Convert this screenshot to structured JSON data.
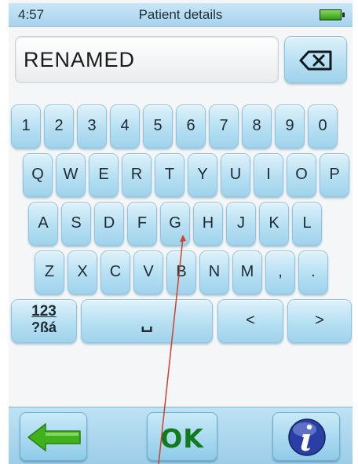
{
  "status": {
    "time": "4:57",
    "title": "Patient details"
  },
  "input": {
    "value": "RENAMED"
  },
  "keyboard": {
    "row1": [
      "1",
      "2",
      "3",
      "4",
      "5",
      "6",
      "7",
      "8",
      "9",
      "0"
    ],
    "row2": [
      "Q",
      "W",
      "E",
      "R",
      "T",
      "Y",
      "U",
      "I",
      "O",
      "P"
    ],
    "row3": [
      "A",
      "S",
      "D",
      "F",
      "G",
      "H",
      "J",
      "K",
      "L"
    ],
    "row4": [
      "Z",
      "X",
      "C",
      "V",
      "B",
      "N",
      "M",
      ",",
      "."
    ],
    "symbols_top": "123",
    "symbols_bottom": "?ßá",
    "space_symbol": "␣",
    "left_arrow": "<",
    "right_arrow": ">"
  },
  "bottom": {
    "ok_label": "OK"
  },
  "colors": {
    "key_fill": "#b6dff2",
    "ok_green": "#117a1c",
    "info_blue": "#2a3fa6",
    "arrow_green": "#3fb21b",
    "pointer_line": "#d0402a"
  }
}
